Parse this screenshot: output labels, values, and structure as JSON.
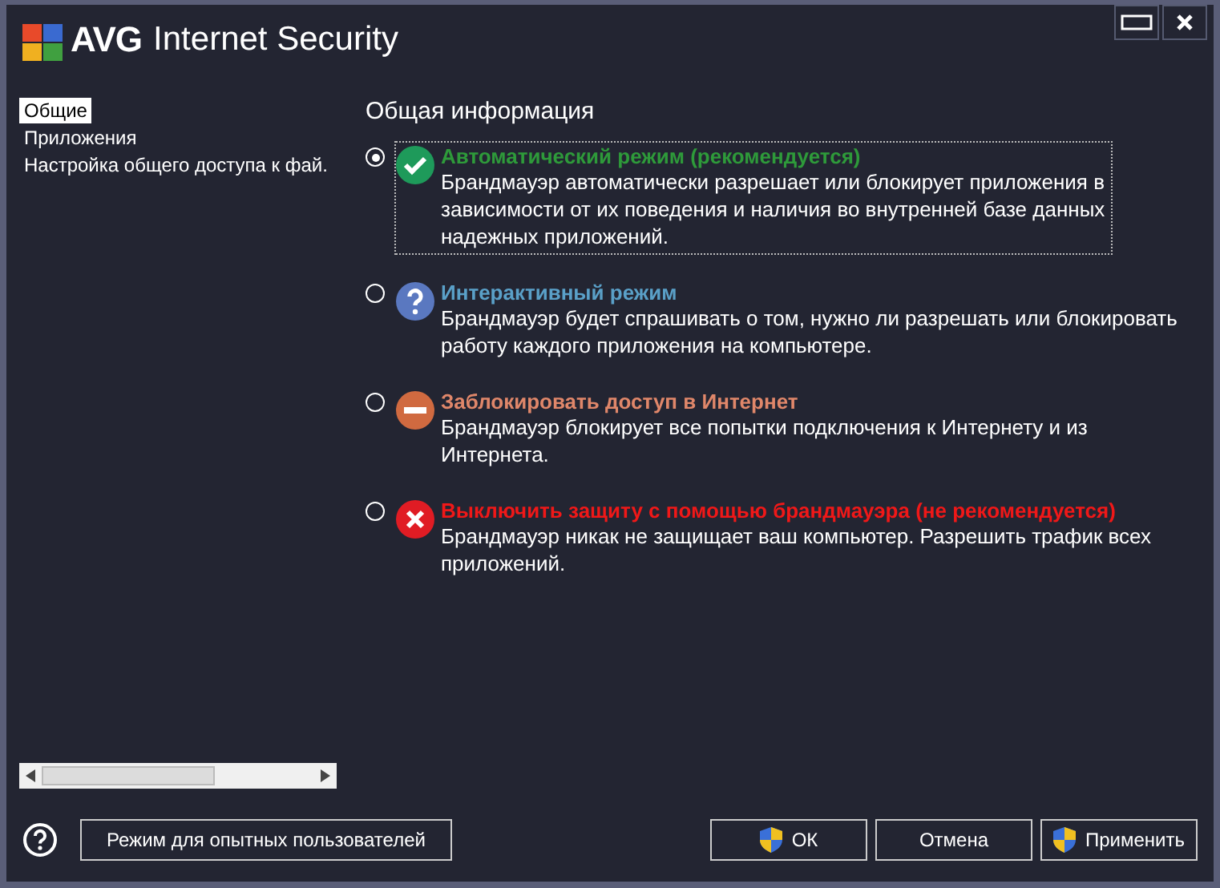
{
  "window": {
    "title_brand": "AVG",
    "title": "Internet Security"
  },
  "sidebar": {
    "items": [
      {
        "label": "Общие",
        "selected": true
      },
      {
        "label": "Приложения",
        "selected": false
      },
      {
        "label": "Настройка общего доступа к фай.",
        "selected": false
      }
    ]
  },
  "heading": "Общая информация",
  "options": [
    {
      "kind": "check",
      "title": "Автоматический режим (рекомендуется)",
      "color": "#2e9a3a",
      "description": "Брандмауэр автоматически разрешает или блокирует приложения в зависимости от их поведения и наличия во внутренней базе данных надежных приложений.",
      "selected": true
    },
    {
      "kind": "question",
      "title": "Интерактивный режим",
      "color": "#5aa0c8",
      "description": "Брандмауэр будет спрашивать о том, нужно ли разрешать или блокировать работу каждого приложения на компьютере.",
      "selected": false
    },
    {
      "kind": "block",
      "title": "Заблокировать доступ в Интернет",
      "color": "#e0876a",
      "description": "Брандмауэр блокирует все попытки подключения к Интернету и из Интернета.",
      "selected": false
    },
    {
      "kind": "cross",
      "title": "Выключить защиту с помощью брандмауэра (не рекомендуется)",
      "color": "#f01818",
      "description": "Брандмауэр никак не защищает ваш компьютер. Разрешить трафик всех приложений.",
      "selected": false
    }
  ],
  "buttons": {
    "expert": "Режим для опытных пользователей",
    "ok": "ОК",
    "cancel": "Отмена",
    "apply": "Применить"
  }
}
